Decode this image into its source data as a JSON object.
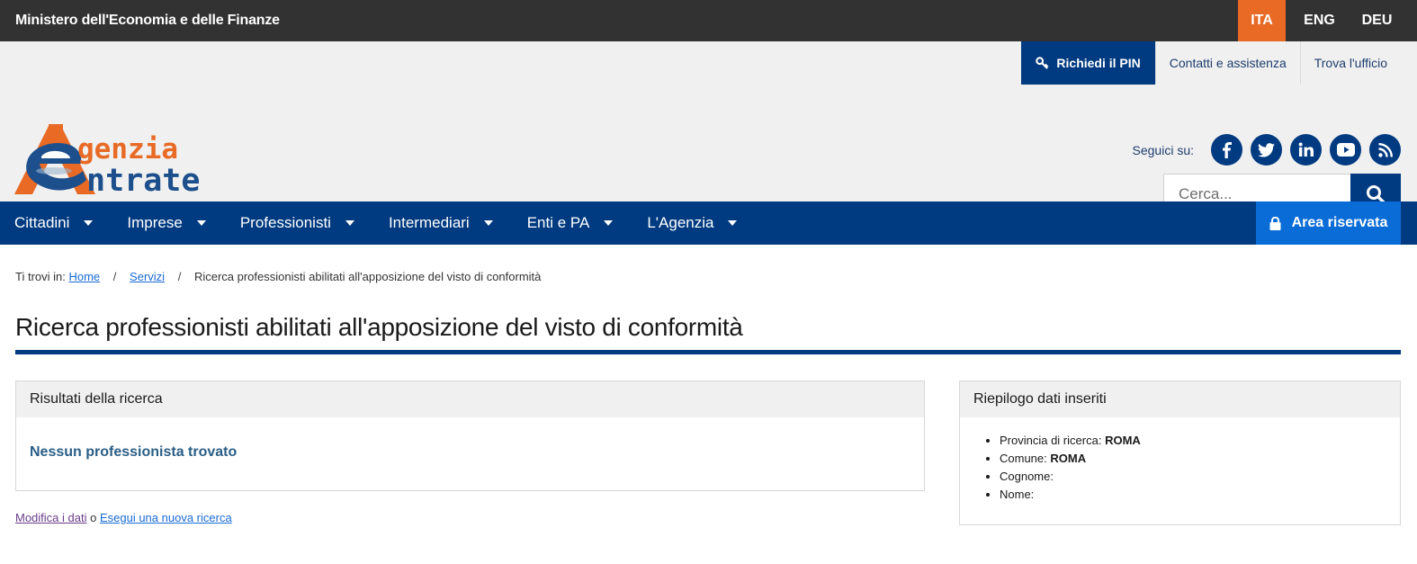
{
  "topbar": {
    "ministry": "Ministero dell'Economia e delle Finanze",
    "languages": [
      "ITA",
      "ENG",
      "DEU"
    ],
    "active_language": "ITA"
  },
  "header": {
    "logo_text": [
      "genzia",
      "ntrate"
    ],
    "utility": {
      "pin": "Richiedi il PIN",
      "contacts": "Contatti e assistenza",
      "office": "Trova l'ufficio"
    },
    "follow_label": "Seguici su:",
    "social": [
      "facebook-icon",
      "twitter-icon",
      "linkedin-icon",
      "youtube-icon",
      "rss-icon"
    ],
    "search_placeholder": "Cerca..."
  },
  "nav": {
    "items": [
      "Cittadini",
      "Imprese",
      "Professionisti",
      "Intermediari",
      "Enti e PA",
      "L'Agenzia"
    ],
    "reserved": "Area riservata"
  },
  "breadcrumb": {
    "prefix": "Ti trovi in:",
    "items": [
      "Home",
      "Servizi"
    ],
    "current": "Ricerca professionisti abilitati all'apposizione del visto di conformità"
  },
  "page": {
    "title": "Ricerca professionisti abilitati all'apposizione del visto di conformità"
  },
  "results": {
    "heading": "Risultati della ricerca",
    "message": "Nessun professionista trovato"
  },
  "summary": {
    "heading": "Riepilogo dati inseriti",
    "items": [
      {
        "label": "Provincia di ricerca:",
        "value": "ROMA"
      },
      {
        "label": "Comune:",
        "value": "ROMA"
      },
      {
        "label": "Cognome:",
        "value": ""
      },
      {
        "label": "Nome:",
        "value": ""
      }
    ]
  },
  "actions": {
    "modify": "Modifica i dati",
    "or": "o",
    "new_search": "Esegui una nuova ricerca"
  },
  "colors": {
    "brand_blue": "#003a80",
    "accent_orange": "#e86a25",
    "reserved_blue": "#0a6cd6"
  }
}
